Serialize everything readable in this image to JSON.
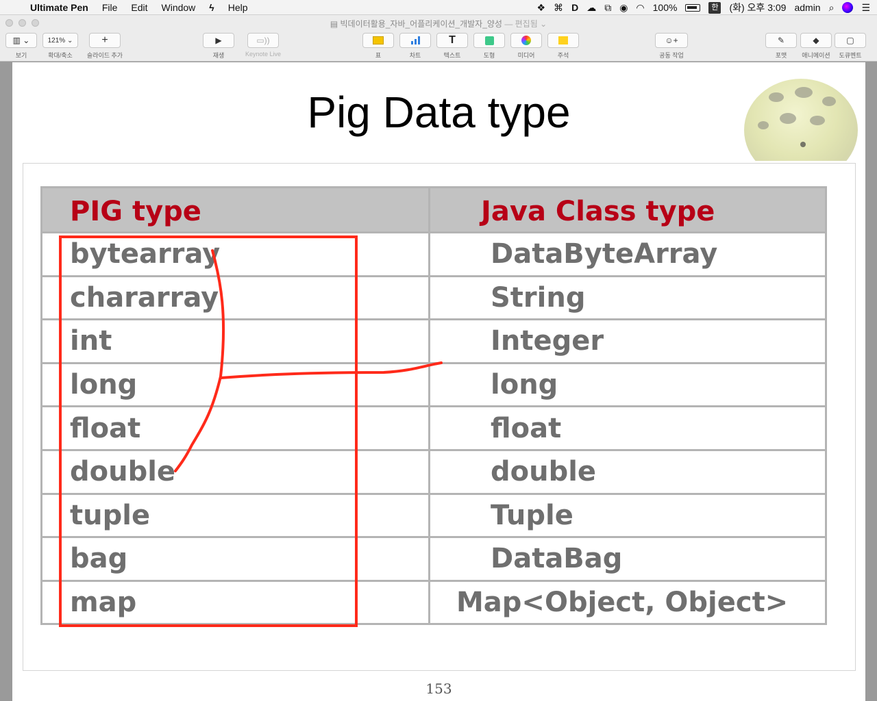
{
  "menubar": {
    "app_name": "Ultimate Pen",
    "items": [
      "File",
      "Edit",
      "Window",
      "Help"
    ],
    "battery": "100%",
    "input_lang": "한",
    "clock": "(화) 오후 3:09",
    "user": "admin"
  },
  "window": {
    "title": "빅데이터활용_자바_어플리케이션_개발자_양성",
    "status": "— 편집됨"
  },
  "toolbar": {
    "view": "보기",
    "zoom_value": "121%",
    "zoom": "확대/축소",
    "add_slide": "슬라이드 추가",
    "play": "재생",
    "keynote_live": "Keynote Live",
    "table": "표",
    "chart": "차트",
    "text": "텍스트",
    "shape": "도형",
    "media": "미디어",
    "comment": "주석",
    "collaborate": "공동 작업",
    "format": "포맷",
    "animate": "애니메이션",
    "document": "도큐멘트"
  },
  "slide": {
    "title": "Pig Data type",
    "page_number": "153",
    "table": {
      "headers": [
        "PIG type",
        "Java Class type"
      ],
      "rows": [
        [
          "bytearray",
          "DataByteArray"
        ],
        [
          "chararray",
          "String"
        ],
        [
          "int",
          "Integer"
        ],
        [
          "long",
          "long"
        ],
        [
          "float",
          "float"
        ],
        [
          "double",
          "double"
        ],
        [
          "tuple",
          "Tuple"
        ],
        [
          "bag",
          "DataBag"
        ],
        [
          "map",
          "Map<Object, Object>"
        ]
      ]
    }
  },
  "colors": {
    "header_text": "#b70016",
    "header_bg": "#c2c2c2",
    "cell_text": "#6f6f6f",
    "annotation": "#ff2a1a"
  }
}
